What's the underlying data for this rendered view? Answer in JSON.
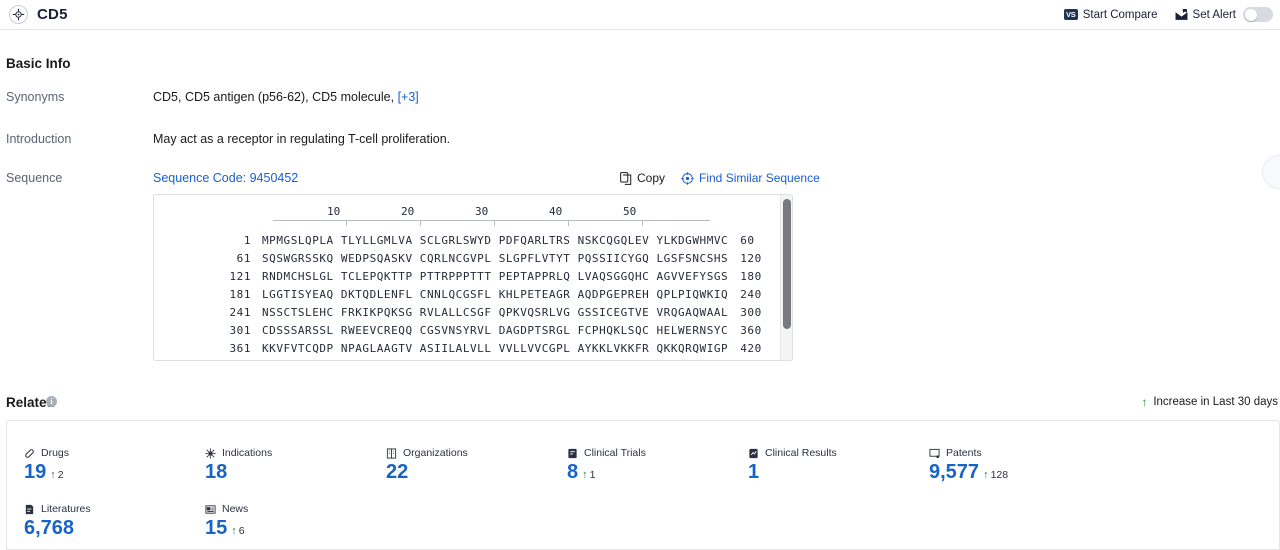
{
  "header": {
    "icon": "target-icon",
    "title": "CD5",
    "start_compare": {
      "label": "Start Compare",
      "badge": "VS"
    },
    "set_alert": {
      "label": "Set Alert",
      "toggle_state": "off"
    }
  },
  "basic_info": {
    "title": "Basic Info",
    "rows": [
      {
        "label": "Synonyms",
        "value": "CD5,  CD5 antigen (p56-62),  CD5 molecule,",
        "more": "[+3]"
      },
      {
        "label": "Introduction",
        "value": "May act as a receptor in regulating T-cell proliferation."
      },
      {
        "label": "Sequence"
      }
    ]
  },
  "sequence": {
    "code_label": "Sequence Code: 9450452",
    "copy_label": "Copy",
    "find_similar_label": "Find Similar Sequence",
    "ruler": [
      "10",
      "20",
      "30",
      "40",
      "50"
    ],
    "lines": [
      {
        "start": "1",
        "chunks": "MPMGSLQPLA TLYLLGMLVA SCLGRLSWYD PDFQARLTRS NSKCQGQLEV YLKDGWHMVC",
        "end": "60"
      },
      {
        "start": "61",
        "chunks": "SQSWGRSSKQ WEDPSQASKV CQRLNCGVPL SLGPFLVTYT PQSSIICYGQ LGSFSNCSHS",
        "end": "120"
      },
      {
        "start": "121",
        "chunks": "RNDMCHSLGL TCLEPQKTTP PTTRPPPTTT PEPTAPPRLQ LVAQSGGQHC AGVVEFYSGS",
        "end": "180"
      },
      {
        "start": "181",
        "chunks": "LGGTISYEAQ DKTQDLENFL CNNLQCGSFL KHLPETEAGR AQDPGEPREH QPLPIQWKIQ",
        "end": "240"
      },
      {
        "start": "241",
        "chunks": "NSSCTSLEHC FRKIKPQKSG RVLALLCSGF QPKVQSRLVG GSSICEGTVE VRQGAQWAAL",
        "end": "300"
      },
      {
        "start": "301",
        "chunks": "CDSSSARSSL RWEEVCREQQ CGSVNSYRVL DAGDPTSRGL FCPHQKLSQC HELWERNSYC",
        "end": "360"
      },
      {
        "start": "361",
        "chunks": "KKVFVTCQDP NPAGLAAGTV ASIILALVLL VVLLVVCGPL AYKKLVKKFR QKKQRQWIGP",
        "end": "420"
      }
    ]
  },
  "related": {
    "title": "Related",
    "info_glyph": "i",
    "legend": "Increase in Last 30 days",
    "cards": [
      {
        "icon": "pill-icon",
        "label": "Drugs",
        "value": "19",
        "delta": "2"
      },
      {
        "icon": "virus-icon",
        "label": "Indications",
        "value": "18",
        "delta": ""
      },
      {
        "icon": "building-icon",
        "label": "Organizations",
        "value": "22",
        "delta": ""
      },
      {
        "icon": "clipboard-edit-icon",
        "label": "Clinical Trials",
        "value": "8",
        "delta": "1"
      },
      {
        "icon": "clipboard-chart-icon",
        "label": "Clinical Results",
        "value": "1",
        "delta": ""
      },
      {
        "icon": "certificate-icon",
        "label": "Patents",
        "value": "9,577",
        "delta": "128"
      },
      {
        "icon": "book-icon",
        "label": "Literatures",
        "value": "6,768",
        "delta": ""
      },
      {
        "icon": "news-icon",
        "label": "News",
        "value": "15",
        "delta": "6"
      }
    ]
  },
  "colors": {
    "link_blue": "#1a5fd0",
    "value_blue": "#1763c6",
    "increase_green": "#1f8a42",
    "label_gray": "#5a6372",
    "border_gray": "#e4e6ea"
  }
}
